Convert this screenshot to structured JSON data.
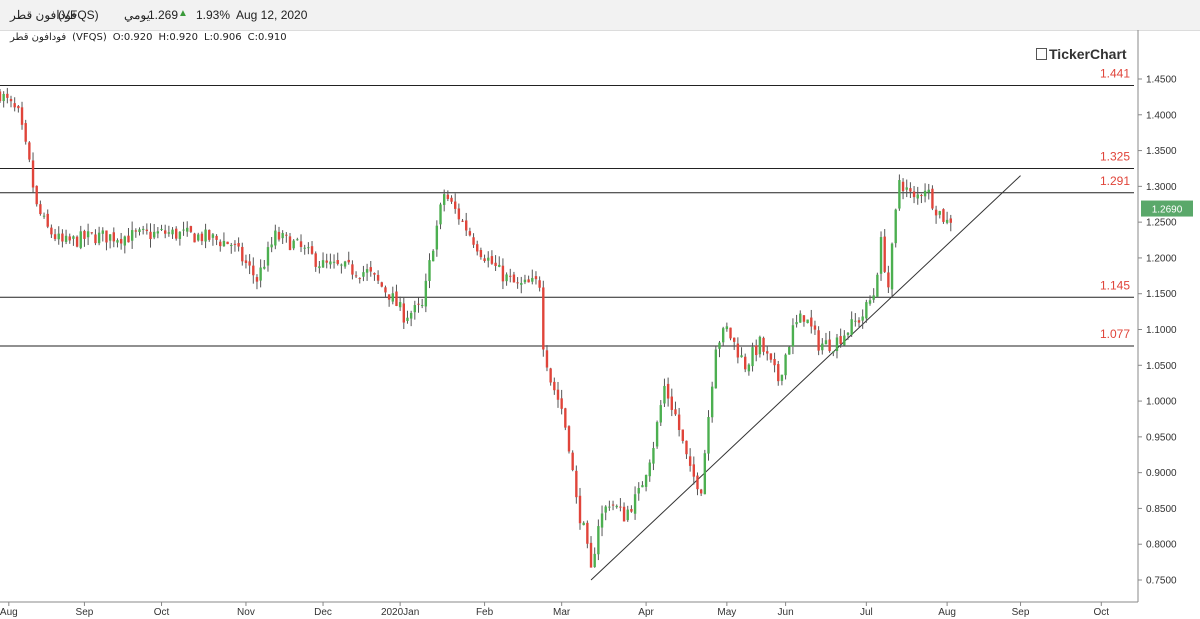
{
  "header": {
    "name": "فودافون قطر",
    "symbol": "(VFQS)",
    "period": "يومي",
    "last": "1.269",
    "change_pct": "1.93%",
    "date": "Aug 12, 2020"
  },
  "ohlc": {
    "name": "فودافون قطر",
    "symbol": "(VFQS)",
    "open": "O:0.920",
    "high": "H:0.920",
    "low": "L:0.906",
    "close": "C:0.910"
  },
  "brand": "TickerChart",
  "colors": {
    "up": "#4caf50",
    "down": "#e0443a",
    "line": "#222222",
    "last_badge": "#5aa86a"
  },
  "chart_data": {
    "type": "candlestick",
    "ylim": [
      0.73,
      1.48
    ],
    "y_ticks": [
      "1.4500",
      "1.4000",
      "1.3500",
      "1.3000",
      "1.2500",
      "1.2000",
      "1.1500",
      "1.1000",
      "1.0500",
      "1.0000",
      "0.9500",
      "0.9000",
      "0.8500",
      "0.8000",
      "0.7500"
    ],
    "x_ticks": [
      {
        "label": "Aug",
        "t": 2.4
      },
      {
        "label": "Sep",
        "t": 23
      },
      {
        "label": "Oct",
        "t": 44
      },
      {
        "label": "Nov",
        "t": 67
      },
      {
        "label": "Dec",
        "t": 88
      },
      {
        "label": "2020Jan",
        "t": 109
      },
      {
        "label": "Feb",
        "t": 132
      },
      {
        "label": "Mar",
        "t": 153
      },
      {
        "label": "Apr",
        "t": 176
      },
      {
        "label": "May",
        "t": 198
      },
      {
        "label": "Jun",
        "t": 214
      },
      {
        "label": "Jul",
        "t": 236
      },
      {
        "label": "Aug",
        "t": 258
      },
      {
        "label": "Sep",
        "t": 278
      },
      {
        "label": "Oct",
        "t": 300
      }
    ],
    "t_range": [
      0,
      310
    ],
    "levels": [
      {
        "value": 1.441,
        "label": "1.441"
      },
      {
        "value": 1.325,
        "label": "1.325"
      },
      {
        "value": 1.291,
        "label": "1.291"
      },
      {
        "value": 1.145,
        "label": "1.145"
      },
      {
        "value": 1.077,
        "label": "1.077"
      }
    ],
    "trendline": [
      {
        "t": 161,
        "y": 0.75
      },
      {
        "t": 278,
        "y": 1.315
      }
    ],
    "last_price": "1.2690",
    "last_value": 1.269,
    "path": [
      {
        "t": 0,
        "y": 1.43
      },
      {
        "t": 5,
        "y": 1.4
      },
      {
        "t": 8,
        "y": 1.33
      },
      {
        "t": 10,
        "y": 1.27
      },
      {
        "t": 13,
        "y": 1.24
      },
      {
        "t": 17,
        "y": 1.22
      },
      {
        "t": 25,
        "y": 1.23
      },
      {
        "t": 35,
        "y": 1.23
      },
      {
        "t": 45,
        "y": 1.235
      },
      {
        "t": 55,
        "y": 1.23
      },
      {
        "t": 63,
        "y": 1.22
      },
      {
        "t": 70,
        "y": 1.17
      },
      {
        "t": 75,
        "y": 1.23
      },
      {
        "t": 80,
        "y": 1.22
      },
      {
        "t": 88,
        "y": 1.19
      },
      {
        "t": 100,
        "y": 1.18
      },
      {
        "t": 106,
        "y": 1.15
      },
      {
        "t": 110,
        "y": 1.12
      },
      {
        "t": 115,
        "y": 1.13
      },
      {
        "t": 118,
        "y": 1.22
      },
      {
        "t": 121,
        "y": 1.29
      },
      {
        "t": 126,
        "y": 1.25
      },
      {
        "t": 131,
        "y": 1.21
      },
      {
        "t": 136,
        "y": 1.18
      },
      {
        "t": 141,
        "y": 1.16
      },
      {
        "t": 146,
        "y": 1.165
      },
      {
        "t": 147.5,
        "y": 1.165,
        "gap": true
      },
      {
        "t": 147.5,
        "y": 1.095
      },
      {
        "t": 150,
        "y": 1.03
      },
      {
        "t": 153,
        "y": 0.99
      },
      {
        "t": 155,
        "y": 0.94
      },
      {
        "t": 157,
        "y": 0.86
      },
      {
        "t": 159,
        "y": 0.82
      },
      {
        "t": 161,
        "y": 0.76
      },
      {
        "t": 163,
        "y": 0.83
      },
      {
        "t": 166,
        "y": 0.86
      },
      {
        "t": 170,
        "y": 0.84
      },
      {
        "t": 174,
        "y": 0.87
      },
      {
        "t": 178,
        "y": 0.94
      },
      {
        "t": 181,
        "y": 1.02
      },
      {
        "t": 184,
        "y": 0.98
      },
      {
        "t": 188,
        "y": 0.9
      },
      {
        "t": 191,
        "y": 0.88
      },
      {
        "t": 195,
        "y": 1.08
      },
      {
        "t": 198,
        "y": 1.1
      },
      {
        "t": 203,
        "y": 1.05
      },
      {
        "t": 207,
        "y": 1.08
      },
      {
        "t": 212,
        "y": 1.03
      },
      {
        "t": 216,
        "y": 1.1
      },
      {
        "t": 219,
        "y": 1.12
      },
      {
        "t": 223,
        "y": 1.08
      },
      {
        "t": 227,
        "y": 1.08
      },
      {
        "t": 231,
        "y": 1.1
      },
      {
        "t": 235,
        "y": 1.12
      },
      {
        "t": 238,
        "y": 1.15
      },
      {
        "t": 240,
        "y": 1.22
      },
      {
        "t": 242,
        "y": 1.16
      },
      {
        "t": 245,
        "y": 1.31
      },
      {
        "t": 249,
        "y": 1.28
      },
      {
        "t": 252,
        "y": 1.3
      },
      {
        "t": 255,
        "y": 1.27
      },
      {
        "t": 258,
        "y": 1.25
      },
      {
        "t": 260,
        "y": 1.26
      }
    ]
  }
}
